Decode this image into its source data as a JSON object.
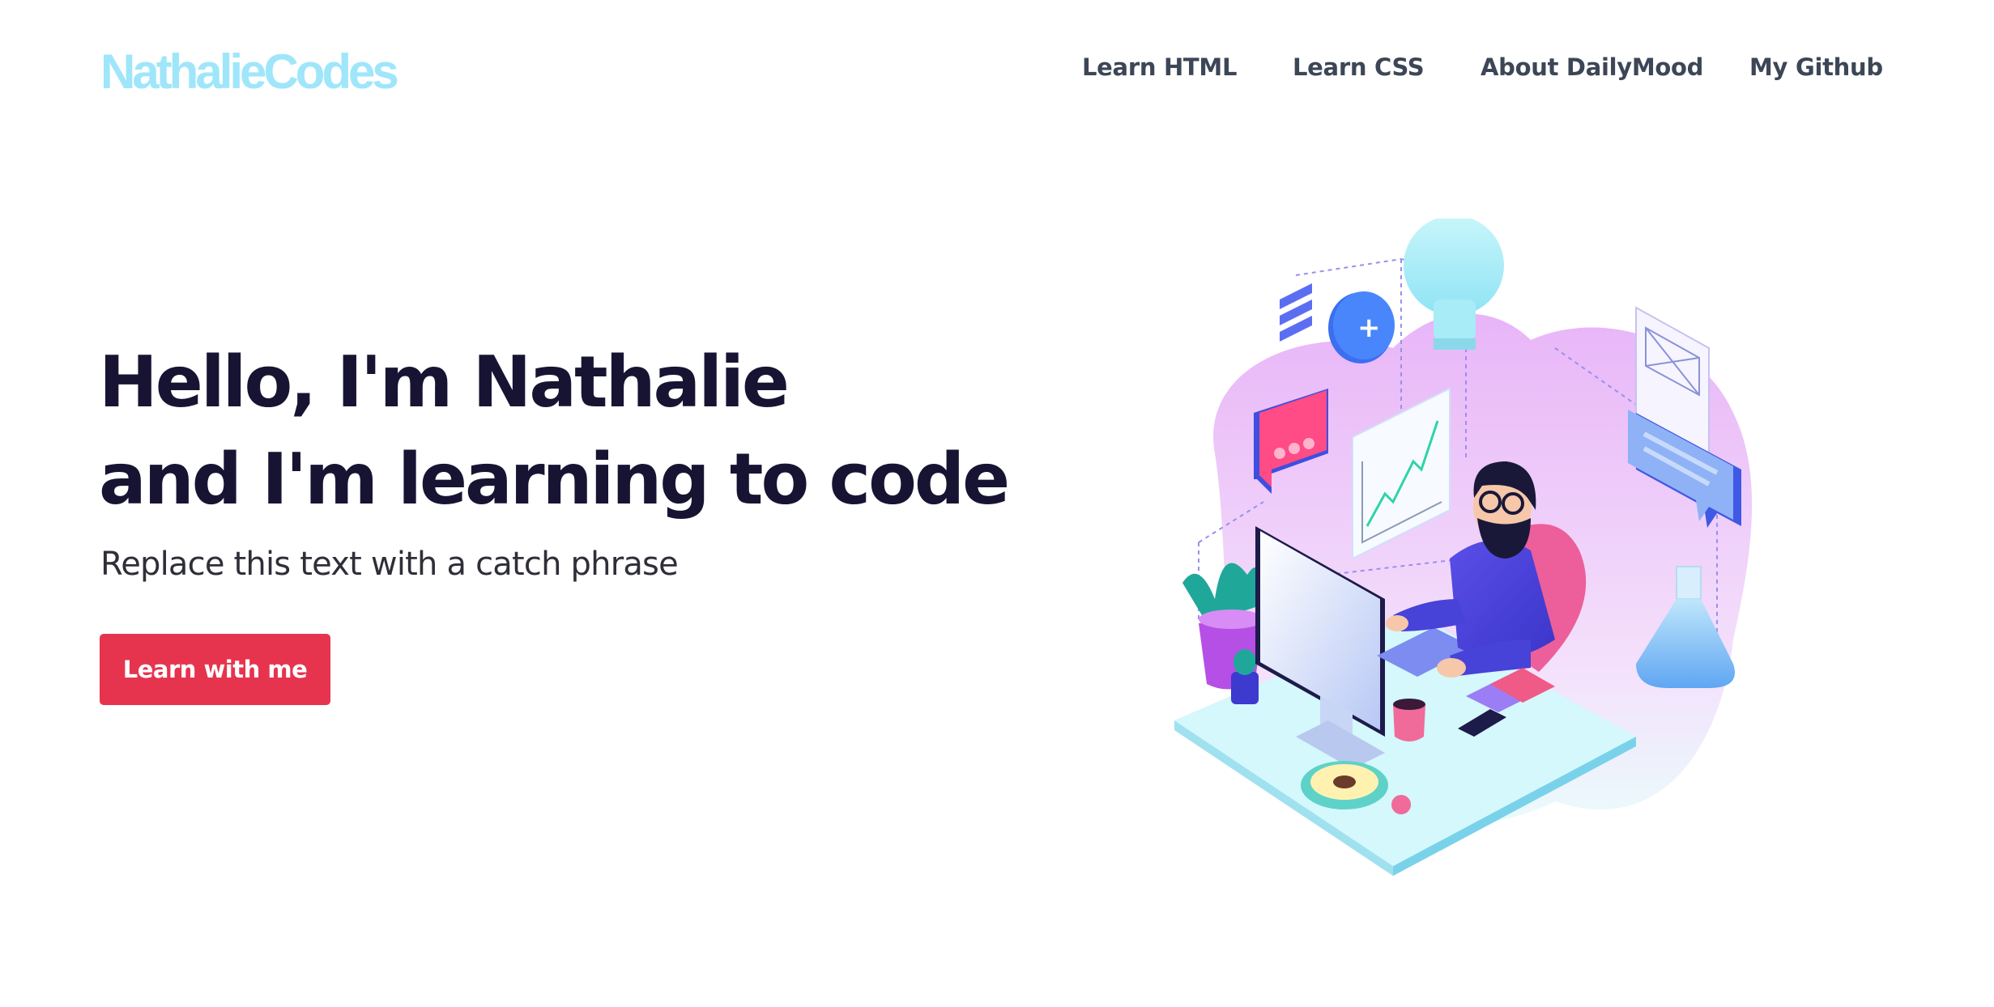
{
  "header": {
    "logo": "NathalieCodes",
    "nav": [
      "Learn HTML",
      "Learn CSS",
      "About DailyMood",
      "My Github"
    ]
  },
  "hero": {
    "title_line1": "Hello, I'm Nathalie",
    "title_line2": "and I'm learning to code",
    "subtitle": "Replace this text with a catch phrase",
    "cta_label": "Learn with me"
  },
  "colors": {
    "logo": "#9fe6fb",
    "cta": "#e6344f",
    "title": "#171433",
    "nav": "#3c4656"
  }
}
